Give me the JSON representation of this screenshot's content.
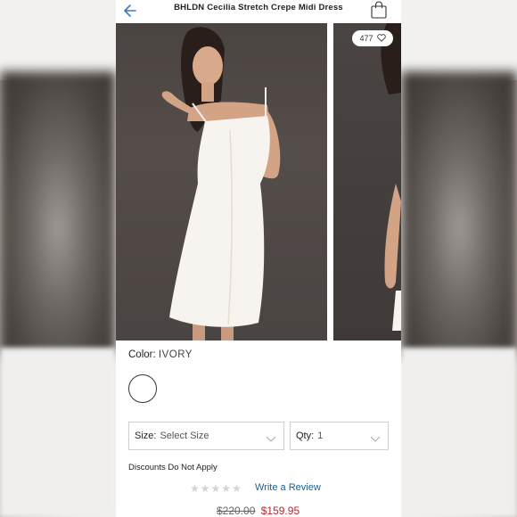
{
  "header": {
    "title": "BHLDN Cecilia Stretch Crepe Midi Dress",
    "back_icon": "back-arrow-icon",
    "bag_icon": "shopping-bag-icon"
  },
  "gallery": {
    "favorites_count": "477",
    "favorite_icon": "heart-icon"
  },
  "color": {
    "label": "Color:",
    "value": "IVORY",
    "swatch_color": "#ffffff"
  },
  "size": {
    "label": "Size:",
    "value": "Select Size"
  },
  "qty": {
    "label": "Qty:",
    "value": "1"
  },
  "discount_note": "Discounts Do Not Apply",
  "reviews": {
    "rating": 0,
    "max_rating": 5,
    "link": "Write a Review"
  },
  "price": {
    "original": "$220.00",
    "sale": "$159.95"
  },
  "colors": {
    "accent_link": "#1d5f8a",
    "sale_red": "#b8262f"
  }
}
